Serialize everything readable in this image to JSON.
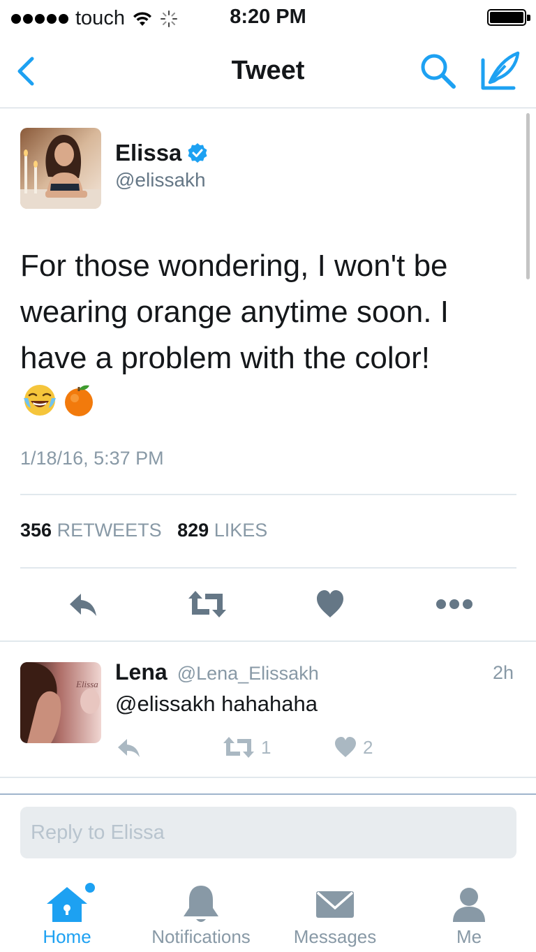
{
  "status_bar": {
    "carrier": "touch",
    "time": "8:20 PM"
  },
  "nav": {
    "title": "Tweet"
  },
  "tweet": {
    "author_name": "Elissa",
    "author_handle": "@elissakh",
    "text": "For those wondering, I won't be wearing orange anytime soon. I have a problem with the color!",
    "emojis": [
      "face-with-tears-of-joy",
      "tangerine"
    ],
    "date": "1/18/16, 5:37 PM",
    "retweets_count": "356",
    "retweets_label": "RETWEETS",
    "likes_count": "829",
    "likes_label": "LIKES"
  },
  "reply": {
    "author_name": "Lena",
    "author_handle": "@Lena_Elissakh",
    "time": "2h",
    "text": "@elissakh hahahaha",
    "retweet_count": "1",
    "like_count": "2"
  },
  "reply_input": {
    "placeholder": "Reply to Elissa"
  },
  "tabs": [
    {
      "label": "Home",
      "icon": "home-icon",
      "active": true
    },
    {
      "label": "Notifications",
      "icon": "bell-icon",
      "active": false
    },
    {
      "label": "Messages",
      "icon": "envelope-icon",
      "active": false
    },
    {
      "label": "Me",
      "icon": "person-icon",
      "active": false
    }
  ],
  "colors": {
    "accent": "#1da1f2",
    "text_primary": "#14171a",
    "text_secondary": "#8899a6",
    "icon_gray": "#657786",
    "divider": "#e1e8ed"
  }
}
